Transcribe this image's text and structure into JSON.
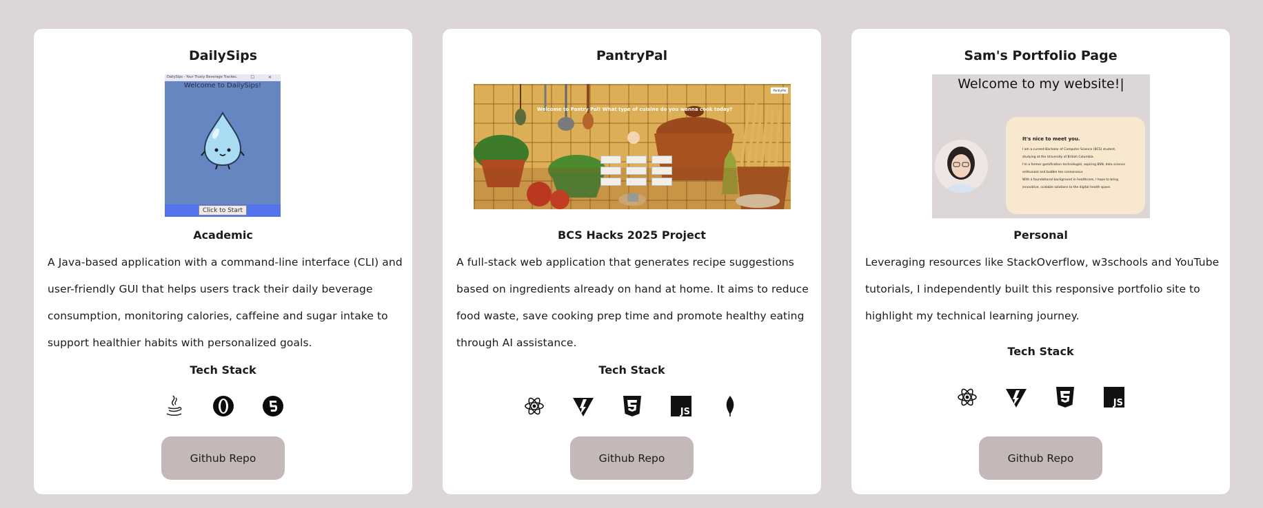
{
  "projects": [
    {
      "title": "DailySips",
      "category": "Academic",
      "description": "A Java-based application with a command-line interface (CLI) and user-friendly GUI that helps users track their daily beverage consumption, monitoring calories, caffeine and sugar intake to support healthier habits with personalized goals.",
      "tech_stack_label": "Tech Stack",
      "tech_icons": [
        "java-icon",
        "opera-icon",
        "html5-icon"
      ],
      "repo_label": "Github Repo",
      "screenshot": {
        "window_title": "DailySips - Your Trusty Beverage Tracker",
        "heading": "Welcome to DailySips!",
        "button": "Click to Start"
      }
    },
    {
      "title": "PantryPal",
      "category": "BCS Hacks 2025 Project",
      "description": "A full-stack web application that generates recipe suggestions based on ingredients already on hand at home. It aims to reduce food waste, save cooking prep time and promote healthy eating through AI assistance.",
      "tech_stack_label": "Tech Stack",
      "tech_icons": [
        "react-icon",
        "vite-icon",
        "css3-icon",
        "javascript-icon",
        "mongodb-icon"
      ],
      "repo_label": "Github Repo",
      "screenshot": {
        "overlay_text": "Welcome to Pantry Pal! What type of cuisine do you wanna cook today?",
        "badge": "PantryPal"
      }
    },
    {
      "title": "Sam's Portfolio Page",
      "category": "Personal",
      "description": "Leveraging resources like StackOverflow, w3schools and YouTube tutorials, I independently built this responsive portfolio site to highlight my technical learning journey.",
      "tech_stack_label": "Tech Stack",
      "tech_icons": [
        "react-icon",
        "vite-icon",
        "css3-icon",
        "javascript-icon"
      ],
      "repo_label": "Github Repo",
      "screenshot": {
        "heading": "Welcome to my website!",
        "bubble_heading": "It's nice to meet you.",
        "bubble_lines": [
          "I am a current Bachelor of Computer Science (BCS) student,",
          "studying at the University of British Columbia.",
          "I'm a former gamification technologist, aspiring BSN, data science",
          "enthusiast and bubble tea connoisseur.",
          "With a foundational background in healthcare, I hope to bring",
          "innovative, scalable solutions to the digital health space."
        ]
      }
    }
  ],
  "colors": {
    "page_bg": "#ddd6d7",
    "card_bg": "#ffffff",
    "button_bg": "#c5b8b8"
  }
}
